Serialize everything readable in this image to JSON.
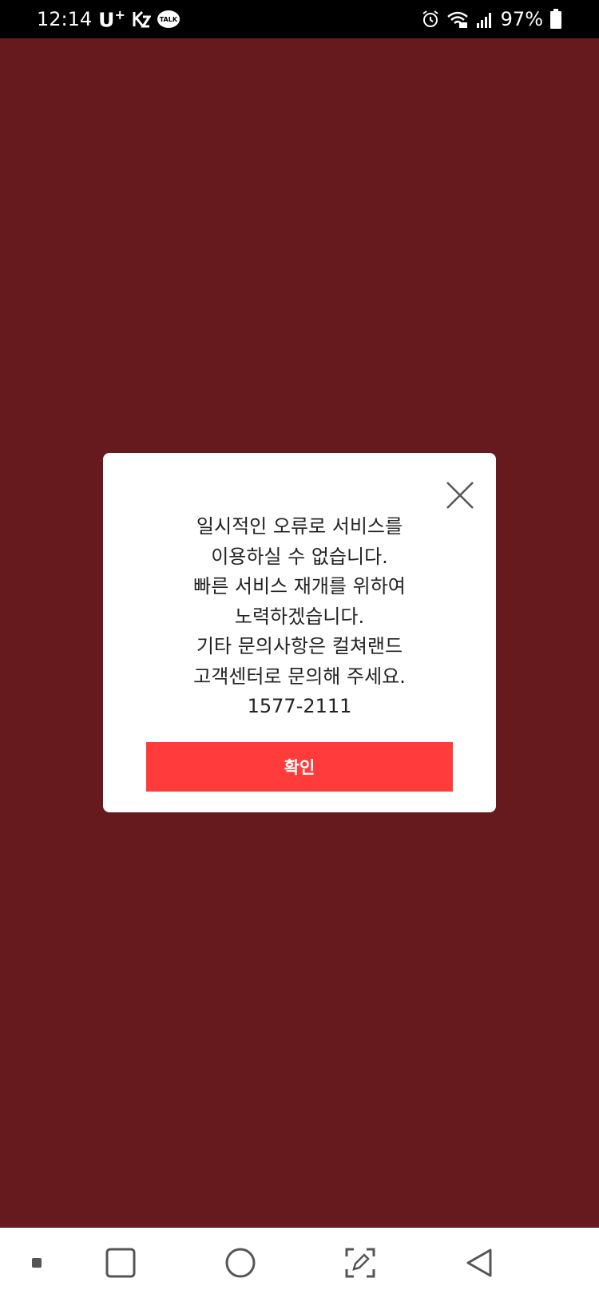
{
  "status_bar": {
    "time": "12:14",
    "carrier": "U",
    "carrier_sup": "+",
    "talk_badge": "TALK",
    "battery": "97%"
  },
  "dialog": {
    "lines": [
      "일시적인 오류로 서비스를",
      "이용하실 수 없습니다.",
      "빠른 서비스 재개를 위하여",
      "노력하겠습니다.",
      "기타 문의사항은 컬쳐랜드",
      "고객센터로 문의해 주세요.",
      "1577-2111"
    ],
    "confirm_label": "확인"
  },
  "nav_bar": {
    "icons": [
      "dot-icon",
      "recents-square-icon",
      "home-circle-icon",
      "screenshot-edit-icon",
      "back-triangle-icon"
    ]
  },
  "colors": {
    "background": "#661a1e",
    "confirm_button": "#ff3b3b",
    "status_bar": "#000000"
  }
}
